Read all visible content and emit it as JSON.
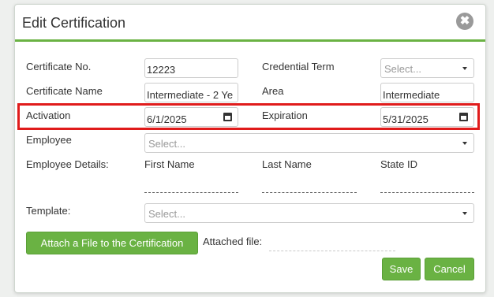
{
  "dialog": {
    "title": "Edit Certification",
    "close_symbol": "✖",
    "labels": {
      "certificate_no": "Certificate No.",
      "credential_term": "Credential Term",
      "certificate_name": "Certificate Name",
      "area": "Area",
      "activation": "Activation",
      "expiration": "Expiration",
      "employee": "Employee",
      "employee_details": "Employee Details:",
      "first_name": "First Name",
      "last_name": "Last Name",
      "state_id": "State ID",
      "template": "Template:",
      "attached_file": "Attached file:"
    },
    "values": {
      "certificate_no": "12223",
      "credential_term_placeholder": "Select...",
      "certificate_name": "Intermediate - 2 Ye",
      "area": "Intermediate",
      "activation": "6/1/2025",
      "expiration": "5/31/2025",
      "employee_placeholder": "Select...",
      "template_placeholder": "Select..."
    },
    "buttons": {
      "attach": "Attach a File to the Certification",
      "save": "Save",
      "cancel": "Cancel"
    }
  },
  "colors": {
    "accent": "#6ab243",
    "highlight": "#e01b1b"
  },
  "icons": [
    "close-icon",
    "calendar-icon",
    "chevron-down-icon"
  ]
}
